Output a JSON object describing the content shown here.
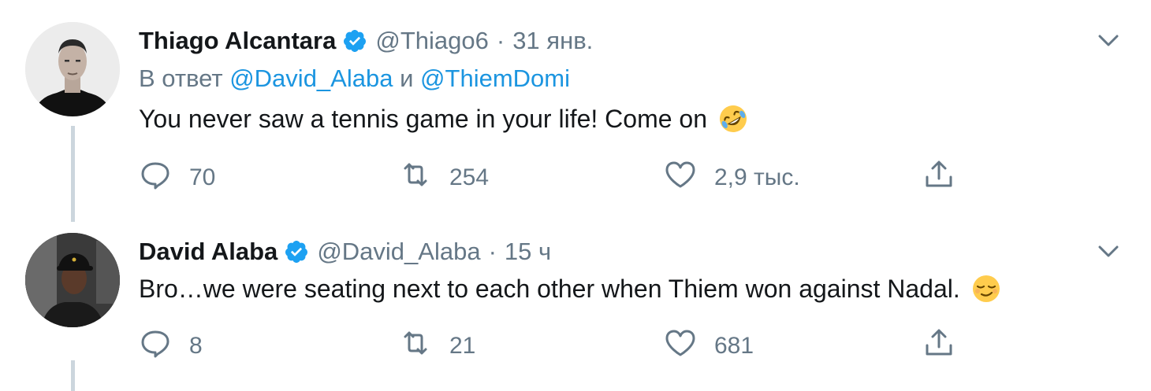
{
  "colors": {
    "text": "#14171a",
    "muted": "#657786",
    "link": "#1b95e0",
    "verified": "#1da1f2",
    "thread_line": "#ccd6dd"
  },
  "tweets": [
    {
      "author_name": "Thiago Alcantara",
      "verified": true,
      "handle": "@Thiago6",
      "separator": "·",
      "time": "31 янв.",
      "reply_prefix": "В ответ",
      "reply_mention_1": "@David_Alaba",
      "reply_conjunction": "и",
      "reply_mention_2": "@ThiemDomi",
      "text": "You never saw a tennis game in your life! Come on",
      "emoji": "rolling-on-floor-laughing-emoji",
      "replies": "70",
      "retweets": "254",
      "likes": "2,9 тыс."
    },
    {
      "author_name": "David Alaba",
      "verified": true,
      "handle": "@David_Alaba",
      "separator": "·",
      "time": "15 ч",
      "text": "Bro…we were seating next to each other when Thiem won against Nadal.",
      "emoji": "relieved-face-emoji",
      "replies": "8",
      "retweets": "21",
      "likes": "681"
    }
  ],
  "icons": {
    "more": "chevron-down-icon",
    "reply": "speech-bubble-icon",
    "retweet": "retweet-icon",
    "like": "heart-icon",
    "share": "share-icon",
    "verified": "verified-badge-icon"
  }
}
